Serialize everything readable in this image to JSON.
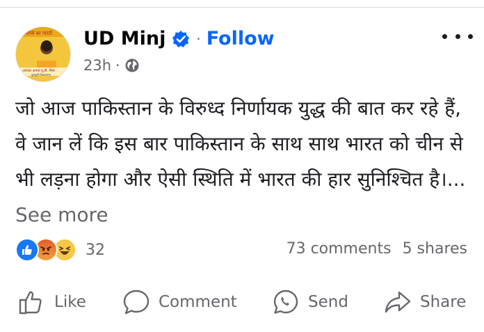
{
  "post": {
    "author": "UD Minj",
    "follow_label": "Follow",
    "time": "23h",
    "text": "जो आज पाकिस्तान के विरुध्द निर्णायक युद्ध की बात कर रहे हैं, वे जान लें कि इस बार पाकिस्तान के साथ साथ भारत को चीन से भी लड़ना होगा और ऐसी स्थिति में भारत की हार सुनिश्चित है।...",
    "see_more": "See more",
    "avatar_text": [
      "भरोसे का गारंटी",
      "आपका अपना यू.डी. मिंज",
      "कुनकुरी विधानसभा"
    ]
  },
  "reactions": {
    "count": "32",
    "types": [
      "like-icon",
      "angry-icon",
      "haha-icon"
    ]
  },
  "stats": {
    "comments": "73 comments",
    "shares": "5 shares"
  },
  "actions": {
    "like": "Like",
    "comment": "Comment",
    "send": "Send",
    "share": "Share"
  },
  "colors": {
    "accent": "#0866ff",
    "secondary_text": "#65676b",
    "like_blue": "#1877f2"
  }
}
